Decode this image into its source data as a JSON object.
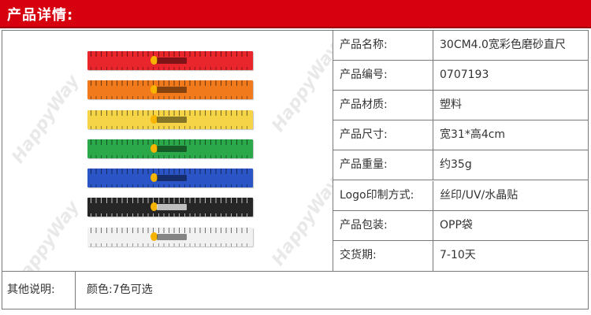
{
  "header": {
    "title": "产品详情:"
  },
  "colors": {
    "header_red": "#d7000f",
    "border": "#7a7a7a"
  },
  "watermark": {
    "text": "HappyWay"
  },
  "rulers": [
    {
      "color": "#e8262c",
      "dark": false
    },
    {
      "color": "#f07a1c",
      "dark": false
    },
    {
      "color": "#f5d447",
      "dark": false
    },
    {
      "color": "#2aa84a",
      "dark": false
    },
    {
      "color": "#2b55c7",
      "dark": false
    },
    {
      "color": "#262626",
      "dark": true
    },
    {
      "color": "#f1f1f1",
      "dark": false
    }
  ],
  "specs": [
    {
      "label": "产品名称:",
      "value": "30CM4.0宽彩色磨砂直尺"
    },
    {
      "label": "产品编号:",
      "value": "0707193"
    },
    {
      "label": "产品材质:",
      "value": "塑料"
    },
    {
      "label": "产品尺寸:",
      "value": "宽31*高4cm"
    },
    {
      "label": "产品重量:",
      "value": "约35g"
    },
    {
      "label": "Logo印制方式:",
      "value": "丝印/UV/水晶贴"
    },
    {
      "label": "产品包装:",
      "value": "OPP袋"
    },
    {
      "label": "交货期:",
      "value": "7-10天"
    }
  ],
  "notes": {
    "label": "其他说明:",
    "value": "颜色:7色可选"
  }
}
